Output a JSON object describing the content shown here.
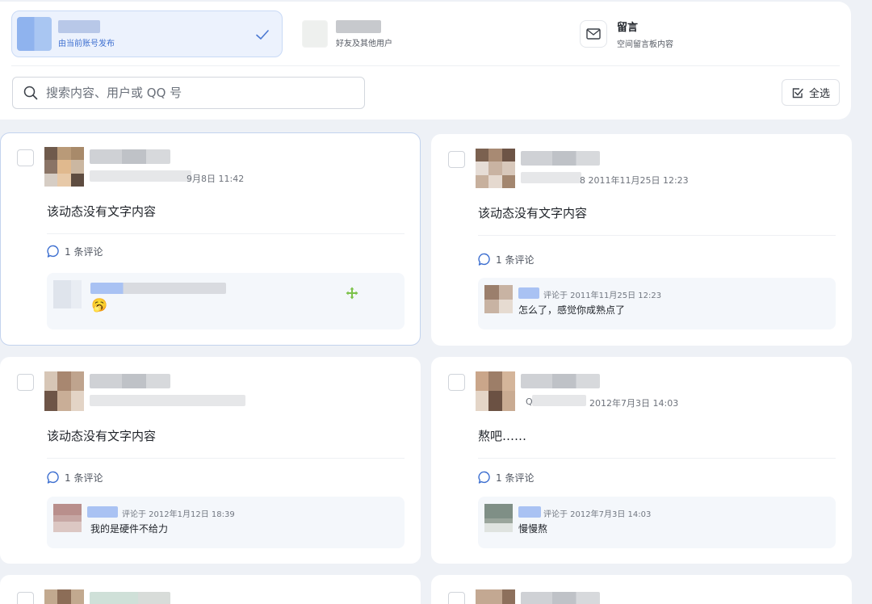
{
  "colors": {
    "accent": "#3d6fd0",
    "background": "#eef1f6",
    "card": "#ffffff",
    "move_icon": "#7cc24a"
  },
  "source_tabs": [
    {
      "title": "",
      "subtitle": "由当前账号发布",
      "selected": true,
      "icon": "check-icon"
    },
    {
      "title": "",
      "subtitle": "好友及其他用户",
      "selected": false
    },
    {
      "title": "留言",
      "subtitle": "空间留言板内容",
      "selected": false,
      "icon": "mail-icon"
    }
  ],
  "search": {
    "placeholder": "搜索内容、用户或 QQ 号",
    "value": ""
  },
  "select_all_label": "全选",
  "posts": [
    {
      "time": "9月8日 11:42",
      "text": "该动态没有文字内容",
      "comment_count_label": "1 条评论",
      "comment": {
        "meta": "",
        "text": "",
        "emoji": "🥱"
      }
    },
    {
      "time": "8  2011年11月25日 12:23",
      "text": "该动态没有文字内容",
      "comment_count_label": "1 条评论",
      "comment": {
        "meta": "评论于  2011年11月25日 12:23",
        "text": "怎么了，感觉你成熟点了"
      }
    },
    {
      "time": "",
      "text": "该动态没有文字内容",
      "comment_count_label": "1 条评论",
      "comment": {
        "meta": "评论于  2012年1月12日 18:39",
        "text": "我的是硬件不给力"
      }
    },
    {
      "time": "2012年7月3日 14:03",
      "meta_prefix": "Q",
      "text": "熬吧……",
      "comment_count_label": "1 条评论",
      "comment": {
        "meta": "评论于  2012年7月3日 14:03",
        "text": "慢慢熬"
      }
    }
  ]
}
